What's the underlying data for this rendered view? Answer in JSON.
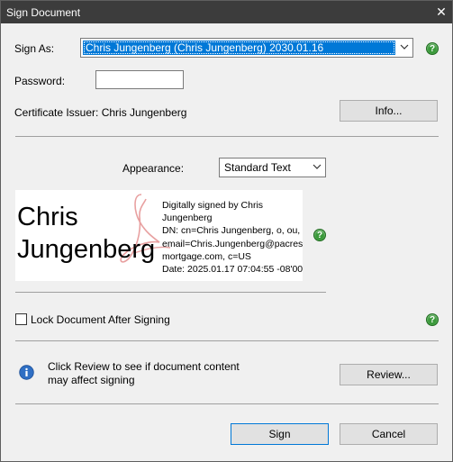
{
  "window": {
    "title": "Sign Document",
    "close_glyph": "✕"
  },
  "sign_as": {
    "label": "Sign As:",
    "selected_value": "Chris Jungenberg (Chris Jungenberg) 2030.01.16"
  },
  "password": {
    "label": "Password:",
    "value": ""
  },
  "certificate": {
    "issuer_text": "Certificate Issuer: Chris Jungenberg",
    "info_button": "Info..."
  },
  "appearance": {
    "label": "Appearance:",
    "selected_value": "Standard Text"
  },
  "preview": {
    "name_line1": "Chris",
    "name_line2": "Jungenberg",
    "details": [
      "Digitally signed by Chris",
      "Jungenberg",
      "DN: cn=Chris Jungenberg, o, ou,",
      "email=Chris.Jungenberg@pacres",
      "mortgage.com, c=US",
      "Date: 2025.01.17 07:04:55 -08'00'"
    ]
  },
  "lock": {
    "label": "Lock Document After Signing",
    "checked": false
  },
  "review": {
    "line1": "Click Review to see if document content",
    "line2": "may affect signing",
    "button": "Review..."
  },
  "footer": {
    "sign_button": "Sign",
    "cancel_button": "Cancel"
  },
  "help_glyph": "?",
  "colors": {
    "titlebar": "#3c3c3c",
    "selection": "#0078d7",
    "help_green": "#3a9a3a",
    "info_blue": "#2f6fc4",
    "watermark": "#e8a0a0"
  }
}
